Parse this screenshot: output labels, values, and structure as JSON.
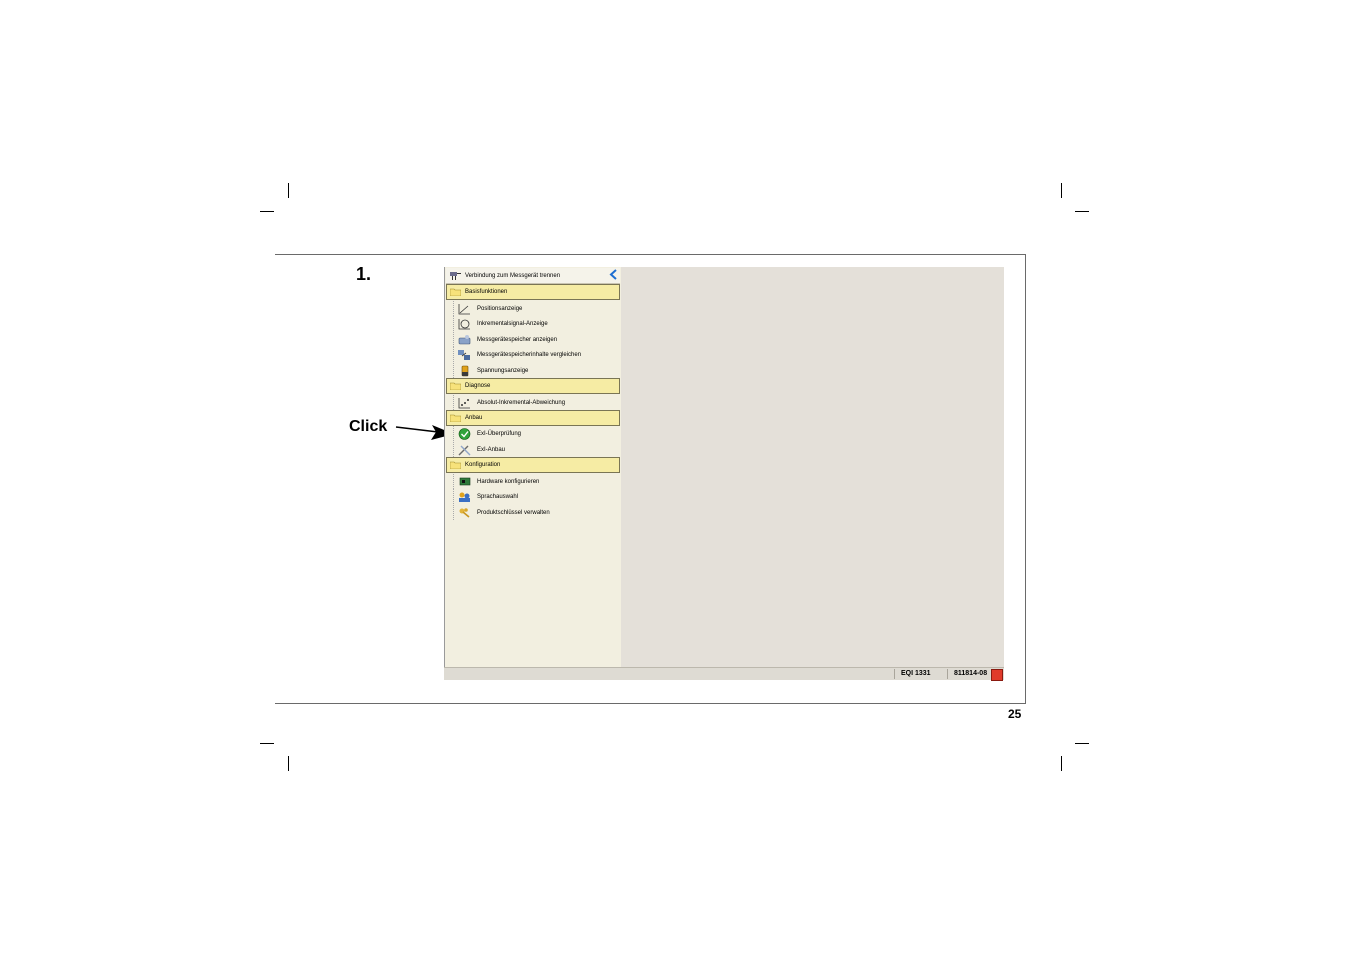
{
  "document": {
    "step_number": "1.",
    "click_label": "Click",
    "page_number": "25"
  },
  "app": {
    "header_label": "Verbindung zum Messgerät trennen",
    "groups": [
      {
        "label": "Basisfunktionen",
        "items": [
          {
            "label": "Positionsanzeige",
            "icon": "position-graph-icon"
          },
          {
            "label": "Inkrementalsignal-Anzeige",
            "icon": "signal-circle-icon"
          },
          {
            "label": "Messgerätespeicher anzeigen",
            "icon": "memory-display-icon"
          },
          {
            "label": "Messgerätespeicherinhalte vergleichen",
            "icon": "memory-compare-icon"
          },
          {
            "label": "Spannungsanzeige",
            "icon": "voltage-battery-icon"
          }
        ]
      },
      {
        "label": "Diagnose",
        "items": [
          {
            "label": "Absolut-Inkremental-Abweichung",
            "icon": "deviation-graph-icon"
          }
        ]
      },
      {
        "label": "Anbau",
        "items": [
          {
            "label": "ExI-Überprüfung",
            "icon": "check-green-icon"
          },
          {
            "label": "ExI-Anbau",
            "icon": "tools-icon"
          }
        ]
      },
      {
        "label": "Konfiguration",
        "items": [
          {
            "label": "Hardware konfigurieren",
            "icon": "hardware-board-icon"
          },
          {
            "label": "Sprachauswahl",
            "icon": "language-people-icon"
          },
          {
            "label": "Produktschlüssel verwalten",
            "icon": "product-keys-icon"
          }
        ]
      }
    ],
    "status": {
      "device": "EQI 1331",
      "id": "811814-08"
    }
  }
}
